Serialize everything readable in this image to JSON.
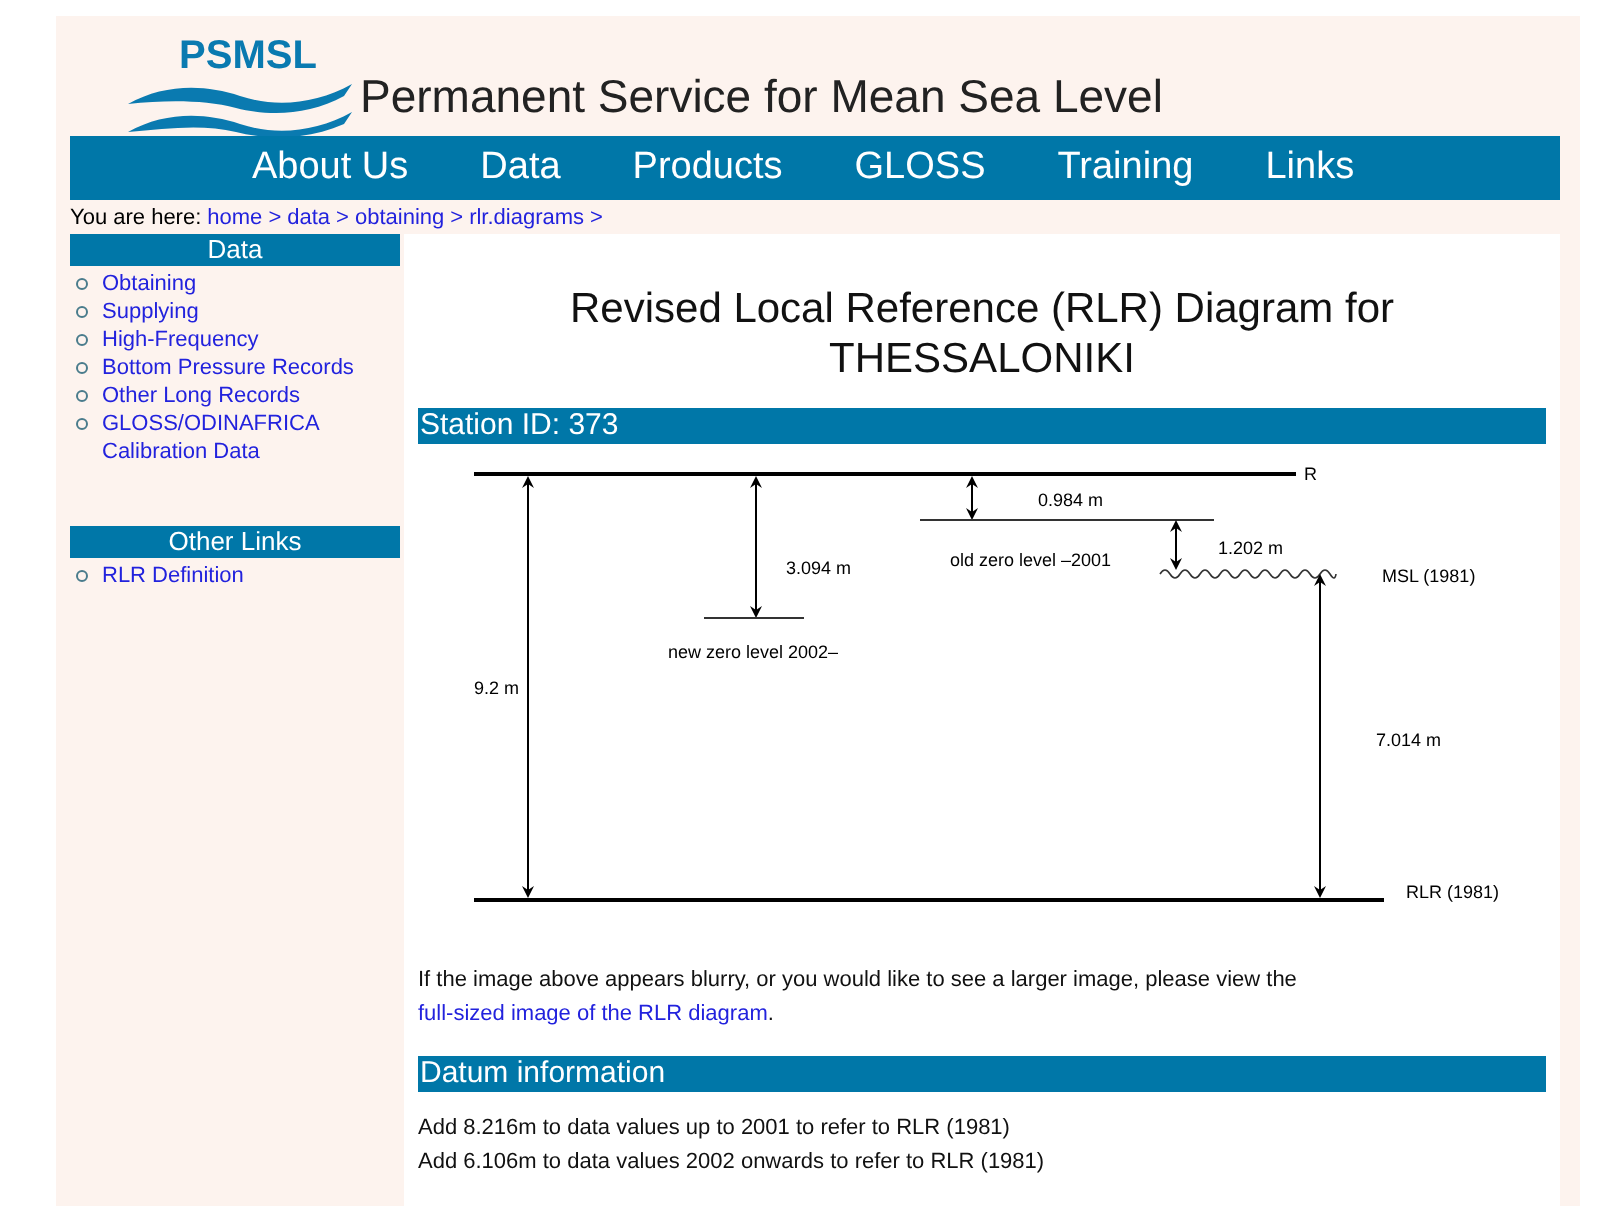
{
  "header": {
    "logo_text": "PSMSL",
    "title": "Permanent Service for Mean Sea Level"
  },
  "nav": [
    "About Us",
    "Data",
    "Products",
    "GLOSS",
    "Training",
    "Links"
  ],
  "breadcrumb": {
    "prefix": "You are here:",
    "links": [
      "home",
      "data",
      "obtaining",
      "rlr.diagrams"
    ],
    "separator": ">"
  },
  "sidebar": [
    {
      "title": "Data",
      "items": [
        "Obtaining",
        "Supplying",
        "High-Frequency",
        "Bottom Pressure Records",
        "Other Long Records",
        "GLOSS/ODINAFRICA Calibration Data"
      ]
    },
    {
      "title": "Other Links",
      "items": [
        "RLR Definition"
      ]
    }
  ],
  "main": {
    "title": "Revised Local Reference (RLR) Diagram for THESSALONIKI",
    "station_heading": "Station ID: 373",
    "diagram": {
      "top_label": "R",
      "total_height": "9.2 m",
      "bottom_label": "RLR (1981)",
      "new_zero_offset": "3.094 m",
      "new_zero_label": "new zero level 2002–",
      "old_zero_offset": "0.984 m",
      "old_zero_label": "old zero level –2001",
      "msl_offset": "1.202 m",
      "msl_label": "MSL (1981)",
      "msl_height": "7.014 m"
    },
    "note": "If the image above appears blurry, or you would like to see a larger image, please view the",
    "note_link": "full-sized image of the RLR diagram",
    "note_end": ".",
    "datum_heading": "Datum information",
    "datum_lines": [
      "Add 8.216m to data values up to 2001 to refer to RLR (1981)",
      "Add 6.106m to data values 2002 onwards to refer to RLR (1981)"
    ]
  }
}
